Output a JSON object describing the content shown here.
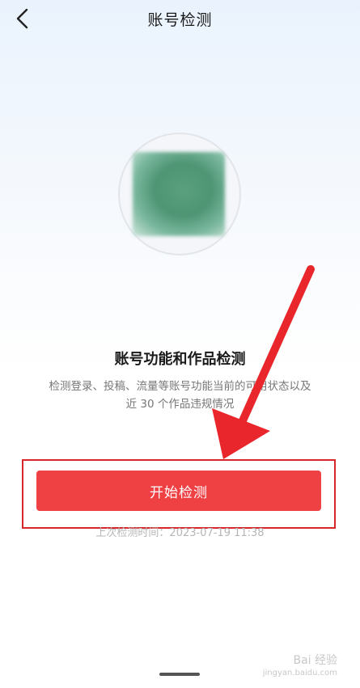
{
  "header": {
    "title": "账号检测"
  },
  "avatar": {
    "description": "blurred profile picture"
  },
  "feature": {
    "title": "账号功能和作品检测",
    "desc_line1": "检测登录、投稿、流量等账号功能当前的可用状态以及",
    "desc_line2": "近 30 个作品违规情况"
  },
  "actions": {
    "start_label": "开始检测"
  },
  "status": {
    "last_check": "上次检测时间：2023-07-19 11:38"
  },
  "watermark": {
    "main": "Bai 经验",
    "sub": "jingyan.baidu.com"
  },
  "colors": {
    "accent": "#ef4044",
    "annotation": "#d9262b"
  }
}
